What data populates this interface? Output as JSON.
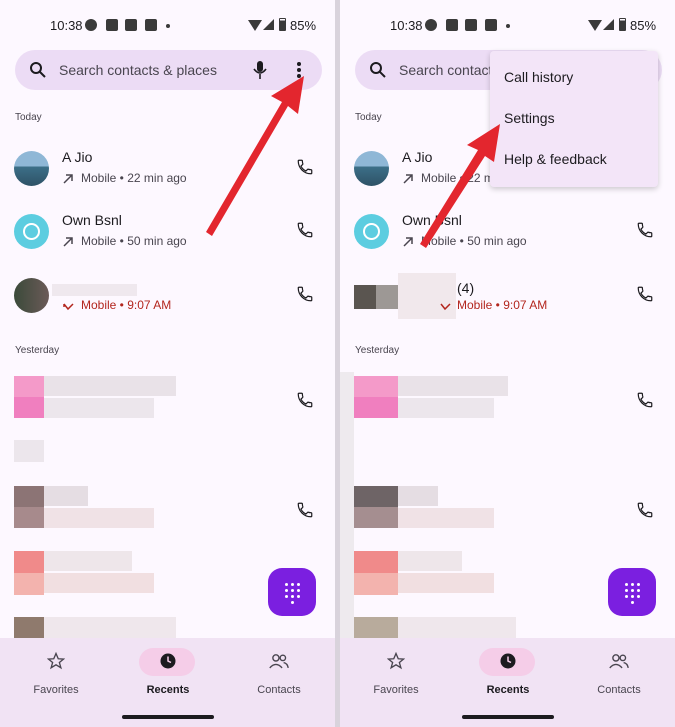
{
  "status": {
    "time": "10:38",
    "battery": "85%"
  },
  "search": {
    "placeholder": "Search contacts & places",
    "placeholder_cut": "Search contact"
  },
  "sections": {
    "today": "Today",
    "yesterday": "Yesterday"
  },
  "calls": [
    {
      "name": "A Jio",
      "detail": "Mobile • 22 min ago",
      "detail_cut": "Mobile • 22 m"
    },
    {
      "name": "Own Bsnl",
      "detail": "Mobile • 50 min ago"
    },
    {
      "name_suffix": "(4)",
      "detail": "Mobile • 9:07 AM"
    }
  ],
  "menu": {
    "items": [
      "Call history",
      "Settings",
      "Help & feedback"
    ]
  },
  "nav": {
    "favorites": "Favorites",
    "recents": "Recents",
    "contacts": "Contacts"
  },
  "colors": {
    "accent": "#7b1fe0",
    "arrow": "#e3262e",
    "search_bg": "#ecdcf5",
    "missed": "#b3261e"
  },
  "icons": [
    "search-icon",
    "mic-icon",
    "more-vert-icon",
    "phone-icon",
    "dialpad-icon",
    "star-icon",
    "clock-icon",
    "people-icon"
  ]
}
